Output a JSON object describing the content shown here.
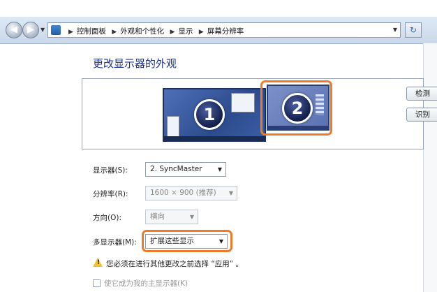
{
  "address_bar": {
    "breadcrumbs": [
      "控制面板",
      "外观和个性化",
      "显示",
      "屏幕分辨率"
    ]
  },
  "page_title": "更改显示器的外观",
  "preview": {
    "monitors": [
      {
        "number": "1",
        "selected": false
      },
      {
        "number": "2",
        "selected": true
      }
    ],
    "detect_label": "检测",
    "identify_label": "识别"
  },
  "settings": {
    "display": {
      "label": "显示器(S):",
      "value": "2. SyncMaster"
    },
    "resolution": {
      "label": "分辨率(R):",
      "value": "1600 × 900 (推荐)"
    },
    "orientation": {
      "label": "方向(O):",
      "value": "横向"
    },
    "multiple_displays": {
      "label": "多显示器(M):",
      "value": "扩展这些显示"
    }
  },
  "warning": "您必须在进行其他更改之前选择 “应用” 。",
  "main_display_checkbox": "使它成为我的主显示器(K)",
  "colors": {
    "highlight": "#ee7a2a",
    "title": "#1e3287"
  }
}
